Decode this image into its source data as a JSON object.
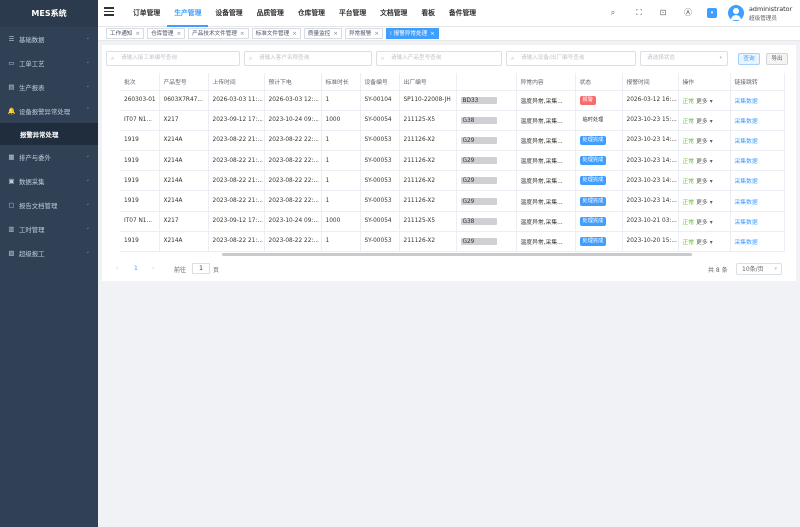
{
  "app": {
    "logo": "MES系统"
  },
  "sidebar": {
    "items": [
      {
        "icon": "list-icon",
        "glyph": "☰",
        "label": "基础数据"
      },
      {
        "icon": "process-icon",
        "glyph": "▭",
        "label": "工单工艺"
      },
      {
        "icon": "report-icon",
        "glyph": "▤",
        "label": "生产报表"
      },
      {
        "icon": "bell-icon",
        "glyph": "🔔",
        "label": "设备报警异常处理"
      },
      {
        "icon": "schedule-icon",
        "glyph": "▦",
        "label": "排产与委外"
      },
      {
        "icon": "data-icon",
        "glyph": "▣",
        "label": "数据采集"
      },
      {
        "icon": "doc-icon",
        "glyph": "▢",
        "label": "报告文档管理"
      },
      {
        "icon": "timer-icon",
        "glyph": "▥",
        "label": "工时管理"
      },
      {
        "icon": "job-icon",
        "glyph": "▧",
        "label": "超级报工"
      }
    ],
    "active_sub": "报警异常处理"
  },
  "topnav": {
    "items": [
      "订单管理",
      "生产管理",
      "设备管理",
      "品质管理",
      "仓库管理",
      "平台管理",
      "文档管理",
      "看板",
      "备件管理"
    ],
    "active_index": 1
  },
  "toolbar": {
    "search_icon": "⌕",
    "fullscreen_icon": "⛶",
    "size_icon": "⊡",
    "theme_icon": "Ⓐ",
    "dropdown_glyph": "▾"
  },
  "user": {
    "name": "administrator",
    "role": "超级管理员"
  },
  "tags": [
    {
      "label": "工作通知"
    },
    {
      "label": "仓库管理"
    },
    {
      "label": "产品技术文件管理"
    },
    {
      "label": "标准文件管理"
    },
    {
      "label": "质量监控"
    },
    {
      "label": "异常报警"
    },
    {
      "label": "报警异常处理",
      "active": true
    }
  ],
  "filters": {
    "work_order_placeholder": "请输入接工单编号查询",
    "customer_placeholder": "请输入客户名称查询",
    "product_model_placeholder": "请输入产品型号查询",
    "device_placeholder": "请输入设备/出厂编号查询",
    "status_placeholder": "请选择状态",
    "query_label": "查询",
    "export_label": "导出"
  },
  "table": {
    "headers": [
      "批次",
      "产品型号",
      "上传时间",
      "预计下电",
      "标准时长",
      "设备编号",
      "出厂编号",
      "",
      "异常内容",
      "状态",
      "报警时间",
      "操作",
      "链接跳转"
    ],
    "rows": [
      [
        "260303-01",
        "0603X7R47...",
        "2026-03-03 11:...",
        "2026-03-03 12:...",
        "1",
        "SY-00104",
        "SP110-22008-JH",
        "BD33",
        "温度异常,采集...",
        "报警",
        "2026-03-12 16:...",
        "正常",
        "采集数据"
      ],
      [
        "IT07 N1...",
        "X217",
        "2023-09-12 17:...",
        "2023-10-24 09:...",
        "1000",
        "SY-00054",
        "211125-X5",
        "G38",
        "温度异常,采集...",
        "临时处理",
        "2023-10-23 15:...",
        "正常",
        "采集数据"
      ],
      [
        "1919",
        "X214A",
        "2023-08-22 21:...",
        "2023-08-22 22:...",
        "1",
        "SY-00053",
        "211126-X2",
        "G29",
        "温度异常,采集...",
        "处理完成",
        "2023-10-23 14:...",
        "正常",
        "采集数据"
      ],
      [
        "1919",
        "X214A",
        "2023-08-22 21:...",
        "2023-08-22 22:...",
        "1",
        "SY-00053",
        "211126-X2",
        "G29",
        "温度异常,采集...",
        "处理完成",
        "2023-10-23 14:...",
        "正常",
        "采集数据"
      ],
      [
        "1919",
        "X214A",
        "2023-08-22 21:...",
        "2023-08-22 22:...",
        "1",
        "SY-00053",
        "211126-X2",
        "G29",
        "温度异常,采集...",
        "处理完成",
        "2023-10-23 14:...",
        "正常",
        "采集数据"
      ],
      [
        "1919",
        "X214A",
        "2023-08-22 21:...",
        "2023-08-22 22:...",
        "1",
        "SY-00053",
        "211126-X2",
        "G29",
        "温度异常,采集...",
        "处理完成",
        "2023-10-23 14:...",
        "正常",
        "采集数据"
      ],
      [
        "IT07 N1...",
        "X217",
        "2023-09-12 17:...",
        "2023-10-24 09:...",
        "1000",
        "SY-00054",
        "211125-X5",
        "G38",
        "温度异常,采集...",
        "处理完成",
        "2023-10-21 03:...",
        "正常",
        "采集数据"
      ],
      [
        "1919",
        "X214A",
        "2023-08-22 21:...",
        "2023-08-22 22:...",
        "1",
        "SY-00053",
        "211126-X2",
        "G29",
        "温度异常,采集...",
        "处理完成",
        "2023-10-20 15:...",
        "正常",
        "采集数据"
      ]
    ],
    "status_styles": {
      "报警": "b-red",
      "临时处理": "b-plain",
      "处理完成": "b-blue"
    },
    "more_label": "更多",
    "more_glyph": "▾"
  },
  "pagination": {
    "prev": "‹",
    "current": "1",
    "next": "›",
    "goto_label": "前往",
    "goto_value": "1",
    "page_label": "页",
    "total": "共 8 条",
    "page_size": "10条/页",
    "dropdown_glyph": "▾"
  }
}
